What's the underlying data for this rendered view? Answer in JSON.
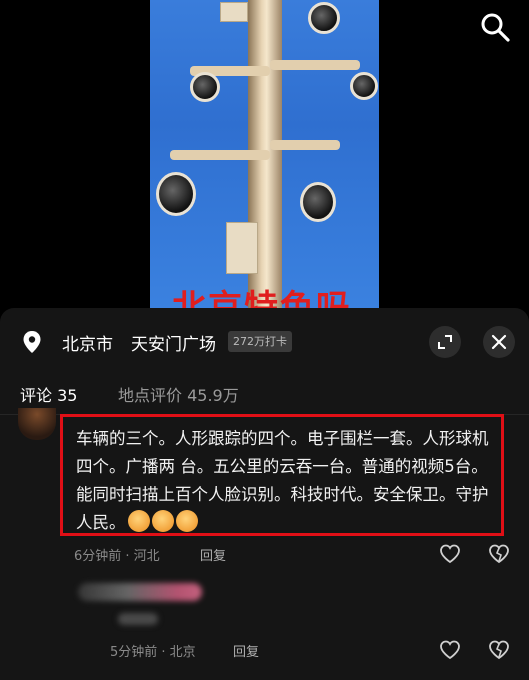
{
  "video": {
    "overlay_text": "北京特色吗"
  },
  "location": {
    "city": "北京市",
    "place": "天安门广场",
    "checkin": "272万打卡"
  },
  "tabs": {
    "comments": "评论 35",
    "rating": "地点评价 45.9万"
  },
  "comment": {
    "text": "车辆的三个。人形跟踪的四个。电子围栏一套。人形球机四个。广播两 台。五公里的云吞一台。普通的视频5台。能同时扫描上百个人脸识别。科技时代。安全保卫。守护人民。",
    "emoji": "thumbs-up x3",
    "time_location": "6分钟前 · 河北",
    "reply_label": "回复"
  },
  "subcomment": {
    "time_location": "5分钟前 · 北京",
    "reply_label": "回复"
  },
  "colors": {
    "highlight_border": "#e00f16",
    "sheet_bg": "#151515"
  },
  "icons": [
    "search-icon",
    "location-pin-icon",
    "expand-icon",
    "close-icon",
    "heart-icon",
    "dislike-heart-icon"
  ]
}
